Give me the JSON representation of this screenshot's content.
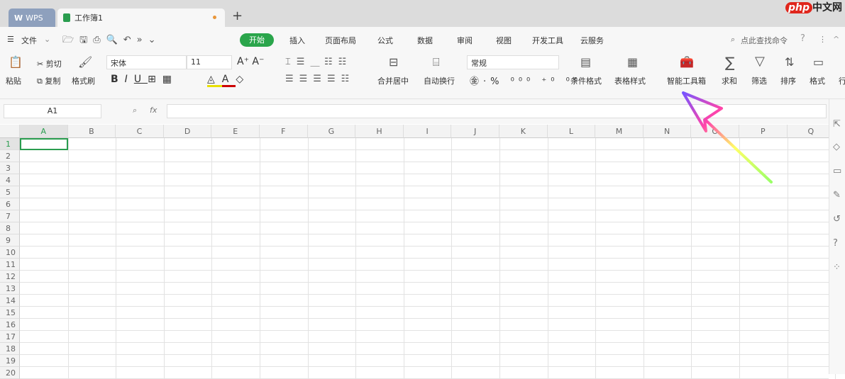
{
  "tabs": {
    "wps": "WPS",
    "doc": "工作簿1",
    "new": "+"
  },
  "watermark": "php中文网",
  "menu": {
    "file": "文件",
    "items": [
      "开始",
      "插入",
      "页面布局",
      "公式",
      "数据",
      "审阅",
      "视图",
      "开发工具",
      "云服务"
    ],
    "search": "点此查找命令"
  },
  "ribbon": {
    "paste": "粘贴",
    "cut": "剪切",
    "copy": "复制",
    "format_painter": "格式刷",
    "font": "宋体",
    "size": "11",
    "merge": "合并居中",
    "wrap": "自动换行",
    "number_format": "常规",
    "cond_format": "条件格式",
    "table_style": "表格样式",
    "smart_toolbox": "智能工具箱",
    "sum": "求和",
    "filter": "筛选",
    "sort": "排序",
    "format": "格式",
    "row_col": "行"
  },
  "formula": {
    "cell_ref": "A1",
    "fx": "fx",
    "value": ""
  },
  "columns": [
    "A",
    "B",
    "C",
    "D",
    "E",
    "F",
    "G",
    "H",
    "I",
    "J",
    "K",
    "L",
    "M",
    "N",
    "O",
    "P",
    "Q"
  ],
  "rows": [
    "1",
    "2",
    "3",
    "4",
    "5",
    "6",
    "7",
    "8",
    "9",
    "10",
    "11",
    "12",
    "13",
    "14",
    "15",
    "16",
    "17",
    "18",
    "19",
    "20"
  ]
}
